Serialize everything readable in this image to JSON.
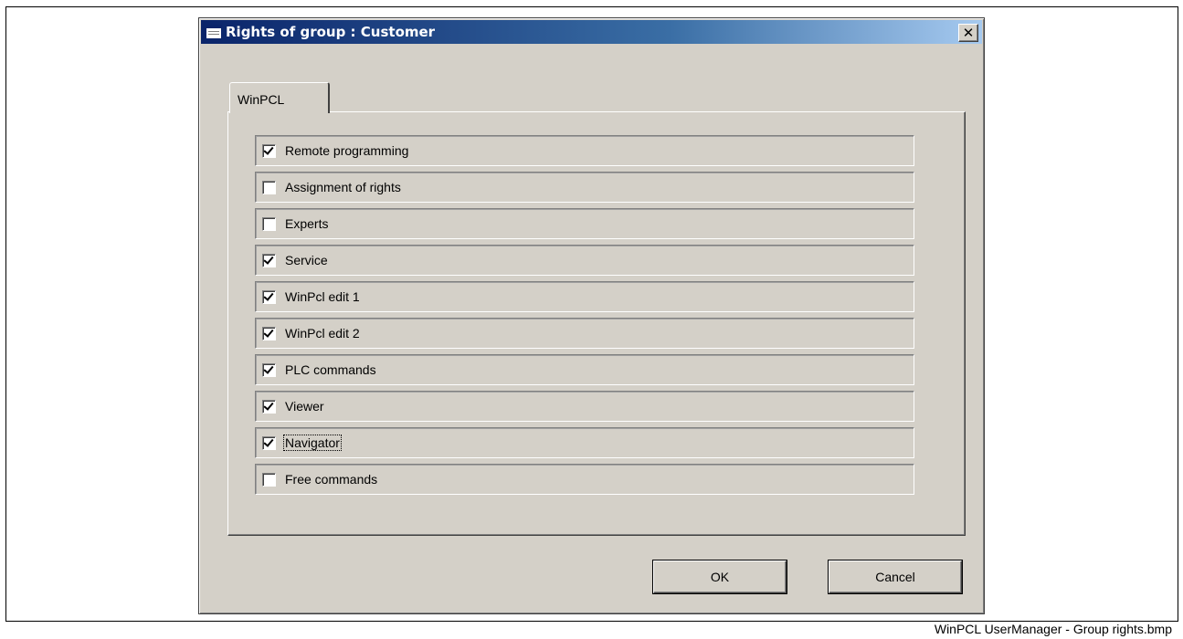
{
  "dialog": {
    "title": "Rights of group : Customer",
    "close_label": "✕"
  },
  "tabs": [
    {
      "label": "WinPCL",
      "active": true
    }
  ],
  "rights": [
    {
      "label": "Remote programming",
      "checked": true
    },
    {
      "label": "Assignment of rights",
      "checked": false
    },
    {
      "label": "Experts",
      "checked": false
    },
    {
      "label": "Service",
      "checked": true
    },
    {
      "label": "WinPcl edit 1",
      "checked": true
    },
    {
      "label": "WinPcl edit 2",
      "checked": true
    },
    {
      "label": "PLC commands",
      "checked": true
    },
    {
      "label": "Viewer",
      "checked": true
    },
    {
      "label": "Navigator",
      "checked": true,
      "focused": true
    },
    {
      "label": "Free commands",
      "checked": false
    }
  ],
  "buttons": {
    "ok_label": "OK",
    "cancel_label": "Cancel"
  },
  "caption": "WinPCL UserManager - Group rights.bmp"
}
